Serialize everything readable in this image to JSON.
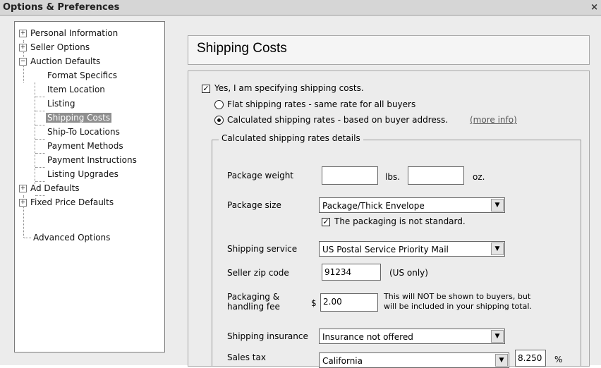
{
  "window": {
    "title": "Options & Preferences",
    "close": "×"
  },
  "tree": [
    {
      "label": "Personal Information",
      "toggle": "+"
    },
    {
      "label": "Seller Options",
      "toggle": "+"
    },
    {
      "label": "Auction Defaults",
      "toggle": "−"
    },
    {
      "label": "Format Specifics"
    },
    {
      "label": "Item Location"
    },
    {
      "label": "Listing"
    },
    {
      "label": "Shipping Costs",
      "selected": true
    },
    {
      "label": "Ship-To Locations"
    },
    {
      "label": "Payment Methods"
    },
    {
      "label": "Payment Instructions"
    },
    {
      "label": "Listing Upgrades"
    },
    {
      "label": "Ad Defaults",
      "toggle": "+"
    },
    {
      "label": "Fixed Price Defaults",
      "toggle": "+"
    },
    {
      "label": "Advanced Options"
    }
  ],
  "page": {
    "title": "Shipping Costs"
  },
  "form": {
    "specifying": {
      "label": "Yes, I am specifying shipping costs.",
      "checked": true
    },
    "flat": {
      "label": "Flat shipping rates - same rate for all buyers",
      "selected": false
    },
    "calculated": {
      "label": "Calculated shipping rates - based on buyer address.",
      "selected": true,
      "more_info": "(more info)"
    },
    "group_label": "Calculated shipping rates details",
    "package_weight": {
      "label": "Package weight",
      "lbs_value": "",
      "lbs_unit": "lbs.",
      "oz_value": "",
      "oz_unit": "oz."
    },
    "package_size": {
      "label": "Package size",
      "value": "Package/Thick Envelope"
    },
    "not_standard": {
      "label": "The packaging is not standard.",
      "checked": true
    },
    "shipping_service": {
      "label": "Shipping service",
      "value": "US Postal Service Priority Mail"
    },
    "zip": {
      "label": "Seller zip code",
      "value": "91234",
      "note": "(US only)"
    },
    "handling": {
      "label_line1": "Packaging &",
      "label_line2": "handling fee",
      "currency": "$",
      "value": "2.00",
      "note_line1": "This will NOT be shown to buyers, but",
      "note_line2": "will be included in your shipping total."
    },
    "insurance": {
      "label": "Shipping insurance",
      "value": "Insurance not offered"
    },
    "sales_tax": {
      "label": "Sales tax",
      "state": "California",
      "rate": "8.250",
      "unit": "%"
    }
  }
}
